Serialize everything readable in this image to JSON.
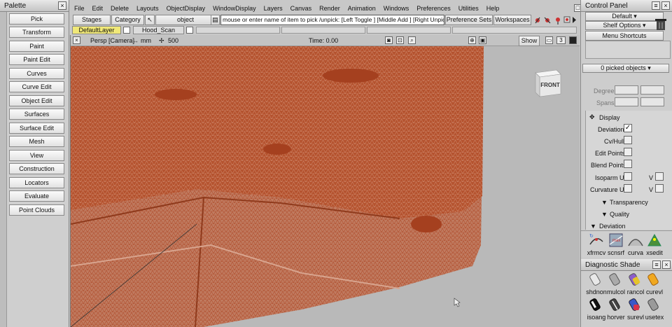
{
  "palette": {
    "title": "Palette",
    "close_icon": "close-icon",
    "items": [
      {
        "label": "Pick"
      },
      {
        "label": "Transform"
      },
      {
        "label": "Paint"
      },
      {
        "label": "Paint Edit"
      },
      {
        "label": "Curves"
      },
      {
        "label": "Curve Edit"
      },
      {
        "label": "Object Edit"
      },
      {
        "label": "Surfaces"
      },
      {
        "label": "Surface Edit"
      },
      {
        "label": "Mesh"
      },
      {
        "label": "View"
      },
      {
        "label": "Construction"
      },
      {
        "label": "Locators"
      },
      {
        "label": "Evaluate"
      },
      {
        "label": "Point Clouds"
      }
    ]
  },
  "menubar": {
    "items": [
      {
        "label": "File"
      },
      {
        "label": "Edit"
      },
      {
        "label": "Delete"
      },
      {
        "label": "Layouts"
      },
      {
        "label": "ObjectDisplay"
      },
      {
        "label": "WindowDisplay"
      },
      {
        "label": "Layers"
      },
      {
        "label": "Canvas"
      },
      {
        "label": "Render"
      },
      {
        "label": "Animation"
      },
      {
        "label": "Windows"
      },
      {
        "label": "Preferences"
      },
      {
        "label": "Utilities"
      },
      {
        "label": "Help"
      }
    ]
  },
  "toolbar": {
    "stages": "Stages",
    "category": "Category",
    "pick_mode": "object",
    "pick_prompt": "mouse or enter name of item to pick /unpick: [Left Toggle ] [Middle Add ] [Right Unpick ]",
    "preference_sets": "Preference Sets",
    "workspaces": "Workspaces"
  },
  "layers": {
    "items": [
      {
        "label": "DefaultLayer"
      },
      {
        "label": "Hood_Scan"
      }
    ]
  },
  "viewport": {
    "camera": "Persp [Camera]",
    "units": "mm",
    "grid": "500",
    "time": "Time: 0.00",
    "show": "Show",
    "view_number": "3",
    "view_cube_label": "FRONT",
    "mesh_color": "#b5532f",
    "background": "#b9b9b9"
  },
  "control_panel": {
    "title": "Control Panel",
    "default": "Default",
    "shelf_options": "Shelf Options",
    "menu_shortcuts": "Menu Shortcuts",
    "picked": "0 picked objects",
    "degree": "Degree",
    "spans": "Spans",
    "display": "Display",
    "deviation": "Deviation",
    "deviation_checked": true,
    "cv_hull": "Cv/Hull",
    "edit_points": "Edit Points",
    "blend_points": "Blend Points",
    "isoparm_u": "Isoparm U",
    "curvature_u": "Curvature U",
    "v": "V",
    "transparency": "Transparency",
    "quality": "Quality",
    "deviation_section": "Deviation",
    "shelf1": [
      {
        "label": "xfrmcv"
      },
      {
        "label": "scnsrf"
      },
      {
        "label": "curva"
      },
      {
        "label": "xsedit"
      }
    ],
    "diagnostic": {
      "title": "Diagnostic Shade",
      "row1": [
        {
          "label": "shdnon"
        },
        {
          "label": "mulcol"
        },
        {
          "label": "rancol"
        },
        {
          "label": "curevl"
        }
      ],
      "row2": [
        {
          "label": "isoang"
        },
        {
          "label": "horver"
        },
        {
          "label": "surevl"
        },
        {
          "label": "usetex"
        }
      ]
    }
  }
}
